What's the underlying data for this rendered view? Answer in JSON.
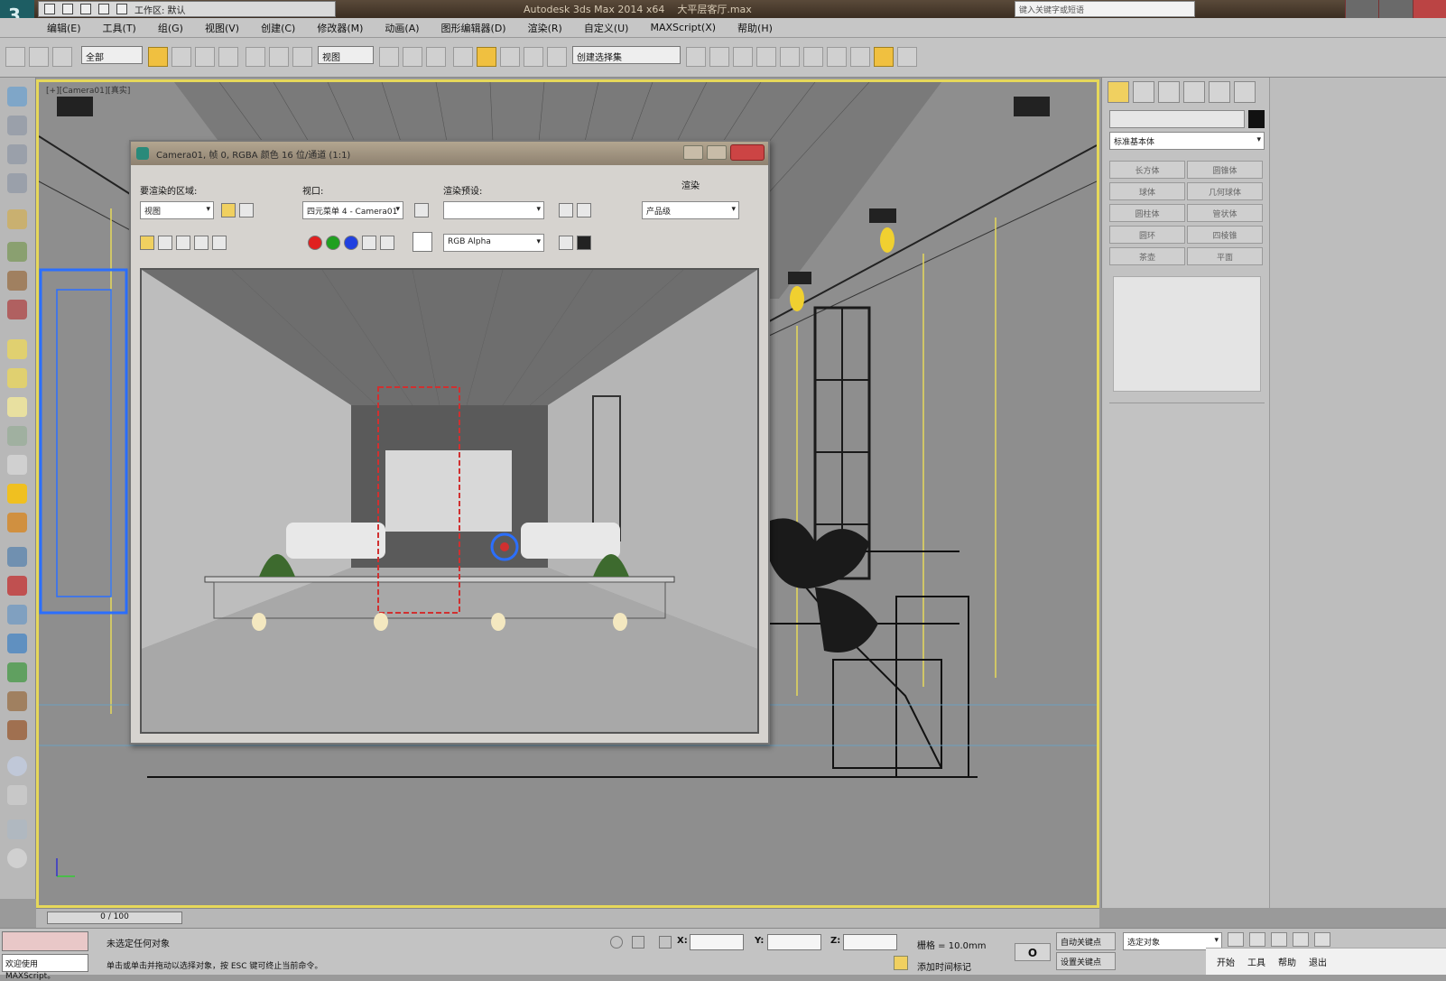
{
  "window": {
    "title": "Autodesk 3ds Max 2014 x64",
    "file_name": "大平层客厅.max",
    "quick_access_label": "工作区: 默认",
    "search_placeholder": "键入关键字或短语"
  },
  "menu": [
    "编辑(E)",
    "工具(T)",
    "组(G)",
    "视图(V)",
    "创建(C)",
    "修改器(M)",
    "动画(A)",
    "图形编辑器(D)",
    "渲染(R)",
    "自定义(U)",
    "MAXScript(X)",
    "帮助(H)"
  ],
  "toolbar": {
    "selection_filter": "全部",
    "reference_coord": "视图",
    "named_selection": "创建选择集"
  },
  "viewport": {
    "label": "[+][Camera01][真实]"
  },
  "dialog": {
    "title": "Camera01, 帧 0, RGBA 颜色 16 位/通道 (1:1)",
    "area_label": "要渲染的区域:",
    "area_value": "视图",
    "viewport_label": "视口:",
    "viewport_value": "四元菜单 4 - Camera01",
    "preset_label": "渲染预设:",
    "preset_value": "",
    "render_label": "渲染",
    "render_value": "产品级",
    "channel_value": "RGB Alpha"
  },
  "command_panel": {
    "name_field": "",
    "category": "标准基本体",
    "buttons": [
      "长方体",
      "圆锥体",
      "球体",
      "几何球体",
      "圆柱体",
      "管状体",
      "圆环",
      "四棱锥",
      "茶壶",
      "平面"
    ]
  },
  "timeline": {
    "frame": "0 / 100"
  },
  "status": {
    "maxscript": "欢迎使用 MAXScript。",
    "selection": "未选定任何对象",
    "prompt": "单击或单击并拖动以选择对象，按 ESC 键可终止当前命令。",
    "grid": "栅格 = 10.0mm",
    "x_label": "X:",
    "y_label": "Y:",
    "z_label": "Z:",
    "x_value": "",
    "y_value": "",
    "z_value": "",
    "auto_key": "自动关键点",
    "set_key": "设置关键点",
    "key_filter": "选定对象",
    "add_time_tag": "添加时间标记",
    "key_button": "O"
  },
  "taskbar": [
    "开始",
    "工具",
    "帮助",
    "退出"
  ],
  "colors": {
    "viewport_border": "#e6d85a",
    "selection_blue": "#2b6fff",
    "selected_red": "#d03030"
  }
}
